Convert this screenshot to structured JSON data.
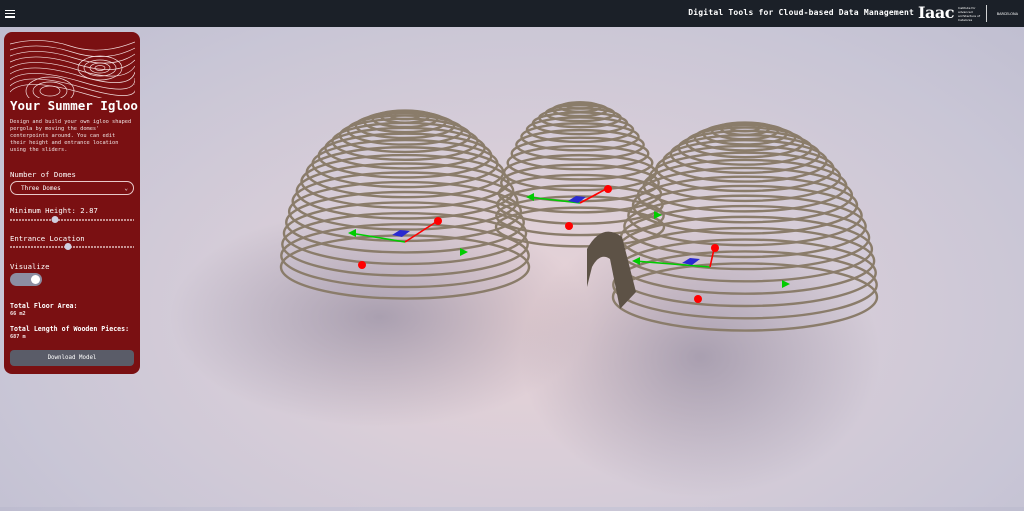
{
  "header": {
    "menu_icon": "hamburger-menu-icon",
    "title": "Digital Tools for Cloud-based Data Management",
    "logo_text": "Iaac",
    "logo_subtext": "Institute for advanced architecture of Catalonia",
    "logo_city": "BARCELONA"
  },
  "panel": {
    "title": "Your Summer Igloo",
    "description": "Design and build your own igloo shaped pergola by moving the domes' centerpoints around. You can edit their height and entrance location using the sliders.",
    "domes_label": "Number of Domes",
    "domes_value": "Three Domes",
    "min_height_label": "Minimum Height: 2.87",
    "min_height_fraction": 0.36,
    "entrance_label": "Entrance Location",
    "entrance_fraction": 0.47,
    "visualize_label": "Visualize",
    "visualize_on": true,
    "floor_area_label": "Total Floor Area:",
    "floor_area_value": "66 m2",
    "wood_length_label": "Total Length of Wooden Pieces:",
    "wood_length_value": "687 m",
    "download_label": "Download Model"
  },
  "colors": {
    "panel_bg": "#7a1012",
    "topbar_bg": "#1b2028",
    "wood": "#8a7c6a",
    "gizmo_x": "#ff0000",
    "gizmo_y": "#00cc00",
    "gizmo_z": "#2a2ad0"
  }
}
